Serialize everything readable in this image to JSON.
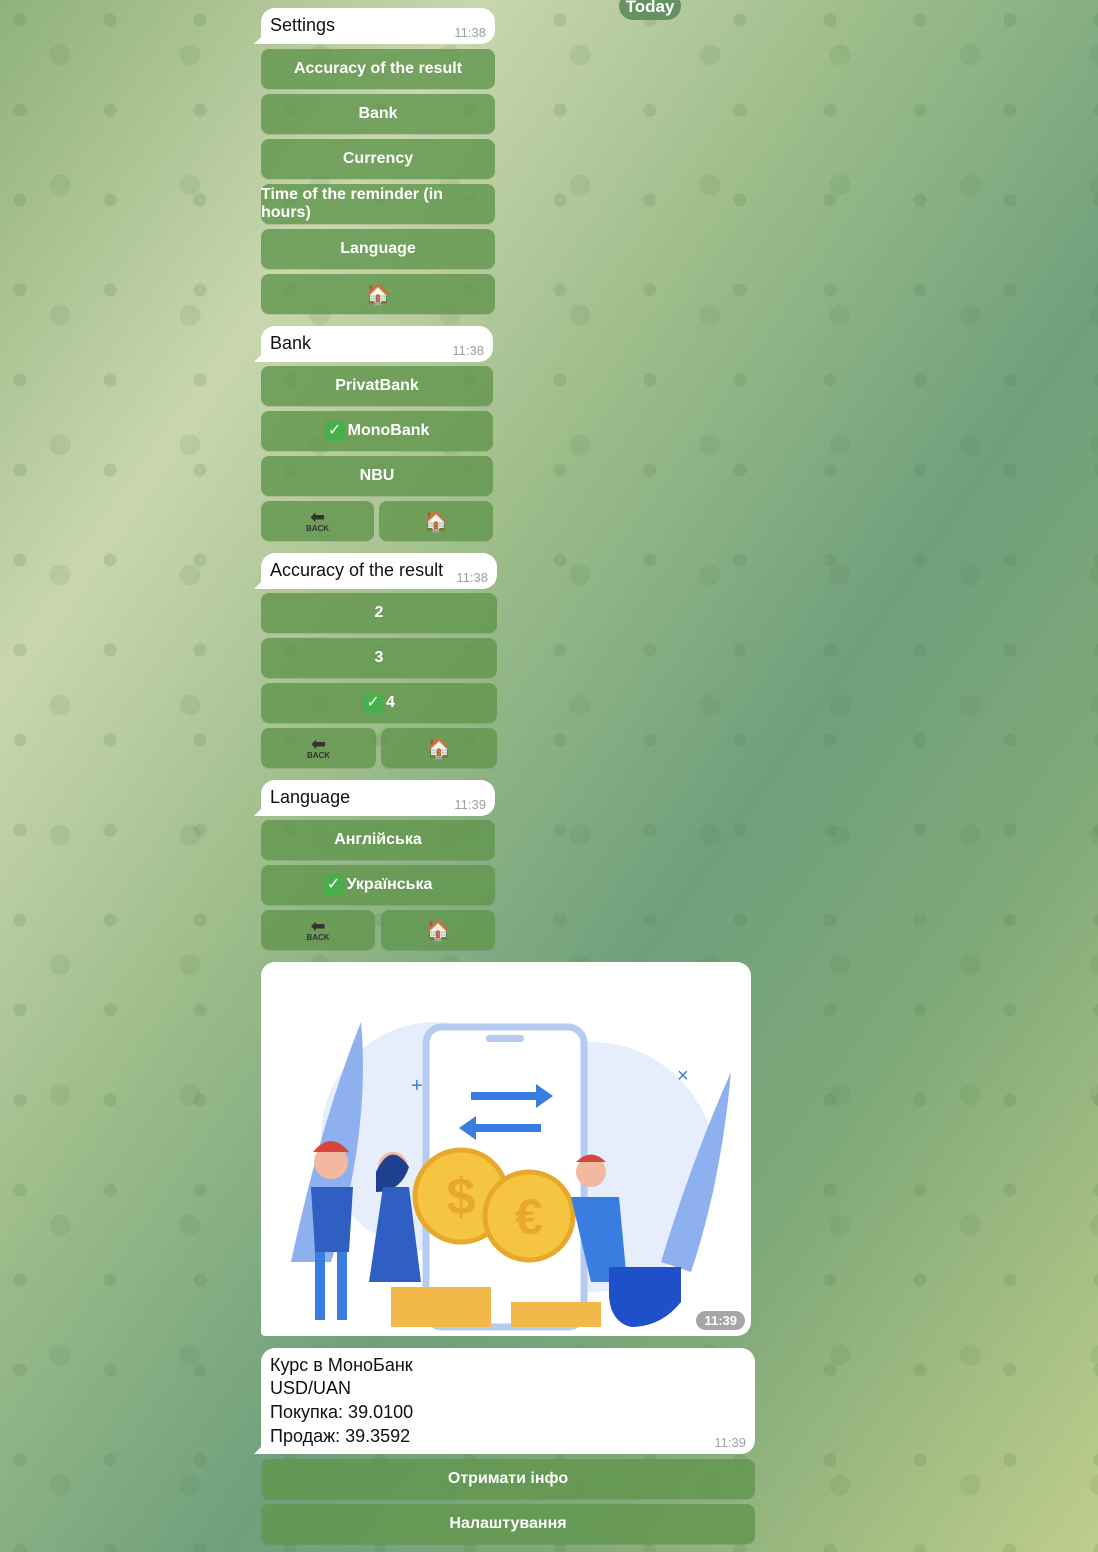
{
  "date_label": "Today",
  "settings_msg": {
    "title": "Settings",
    "time": "11:38",
    "buttons": [
      "Accuracy of the result",
      "Bank",
      "Currency",
      "Time of the reminder (in hours)",
      "Language"
    ],
    "home_icon": "house-icon"
  },
  "bank_msg": {
    "title": "Bank",
    "time": "11:38",
    "options": [
      "PrivatBank",
      "MonoBank",
      "NBU"
    ],
    "selected": "MonoBank",
    "back_label": "BACK"
  },
  "accuracy_msg": {
    "title": "Accuracy of the result",
    "time": "11:38",
    "options": [
      "2",
      "3",
      "4"
    ],
    "selected": "4",
    "back_label": "BACK"
  },
  "language_msg": {
    "title": "Language",
    "time": "11:39",
    "options": [
      "Англійська",
      "Українська"
    ],
    "selected": "Українська",
    "back_label": "BACK"
  },
  "photo_msg": {
    "time": "11:39"
  },
  "rate_msg": {
    "lines": [
      "Курс в МоноБанк",
      "USD/UAN",
      "Покупка: 39.0100",
      "Продаж: 39.3592"
    ],
    "time": "11:39"
  },
  "bottom_buttons": [
    "Отримати інфо",
    "Налаштування"
  ],
  "colors": {
    "button": "#62964e",
    "check": "#48b04a"
  }
}
